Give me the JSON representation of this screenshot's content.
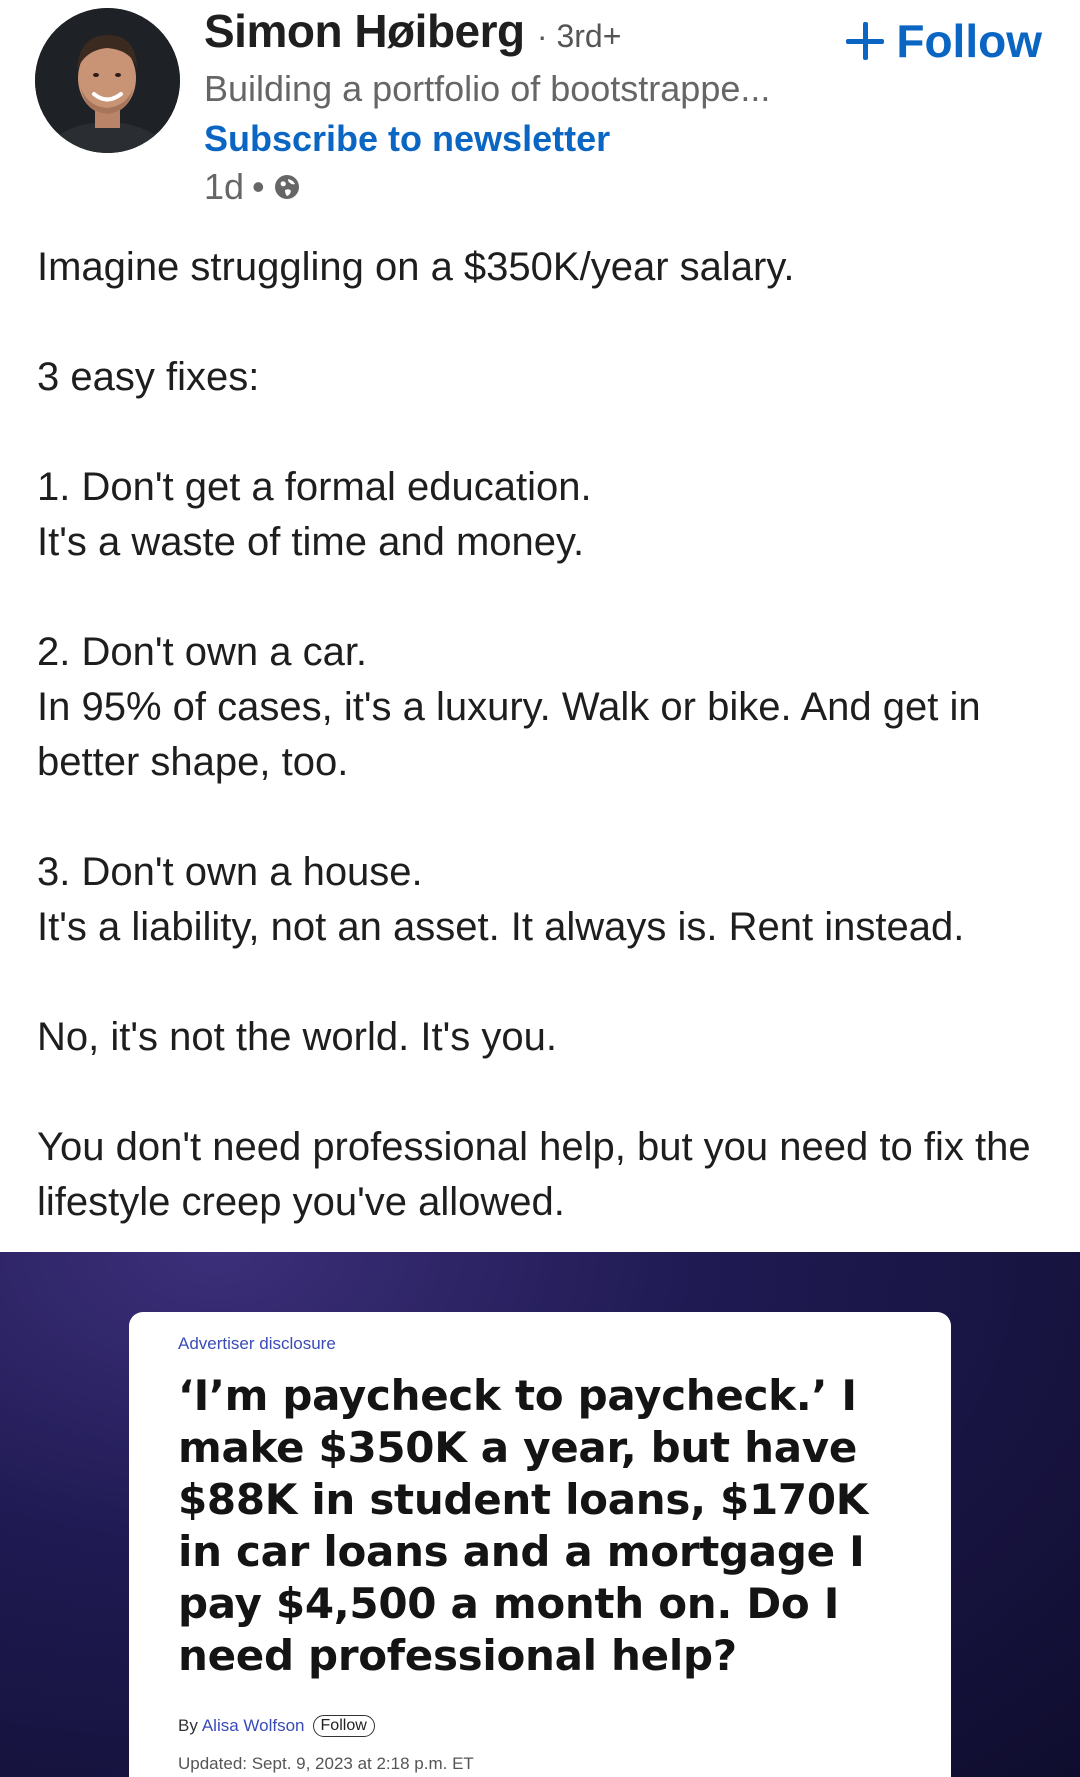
{
  "post": {
    "author": {
      "name": "Simon Høiberg",
      "degree": "· 3rd+",
      "headline": "Building a portfolio of bootstrappe...",
      "newsletter_label": "Subscribe to newsletter",
      "time": "1d",
      "time_separator": "•",
      "visibility_icon": "globe-icon"
    },
    "follow_label": "Follow",
    "follow_icon": "plus-icon",
    "accent_color": "#0a66c2",
    "body": {
      "intro": "Imagine struggling on a $350K/year salary.",
      "fixes_heading": "3 easy fixes:",
      "fix1_title": "1. Don't get a formal education.",
      "fix1_text": "It's a waste of time and money.",
      "fix2_title": "2. Don't own a car.",
      "fix2_text": "In 95% of cases, it's a luxury. Walk or bike. And get in better shape, too.",
      "fix3_title": "3. Don't own a house.",
      "fix3_text": "It's a liability, not an asset. It always is. Rent instead.",
      "line_world": "No, it's not the world. It's you.",
      "closing": "You don't need professional help, but you need to fix the lifestyle creep you've allowed."
    }
  },
  "article": {
    "disclosure": "Advertiser disclosure",
    "title": "‘I’m paycheck to paycheck.’ I make $350K a year, but have $88K in student loans, $170K in car loans and a mortgage I pay $4,500 a month on. Do I need professional help?",
    "byline_prefix": "By",
    "byline_author": "Alisa Wolfson",
    "byline_follow": "Follow",
    "updated": "Updated: Sept. 9, 2023 at 2:18 p.m. ET"
  }
}
